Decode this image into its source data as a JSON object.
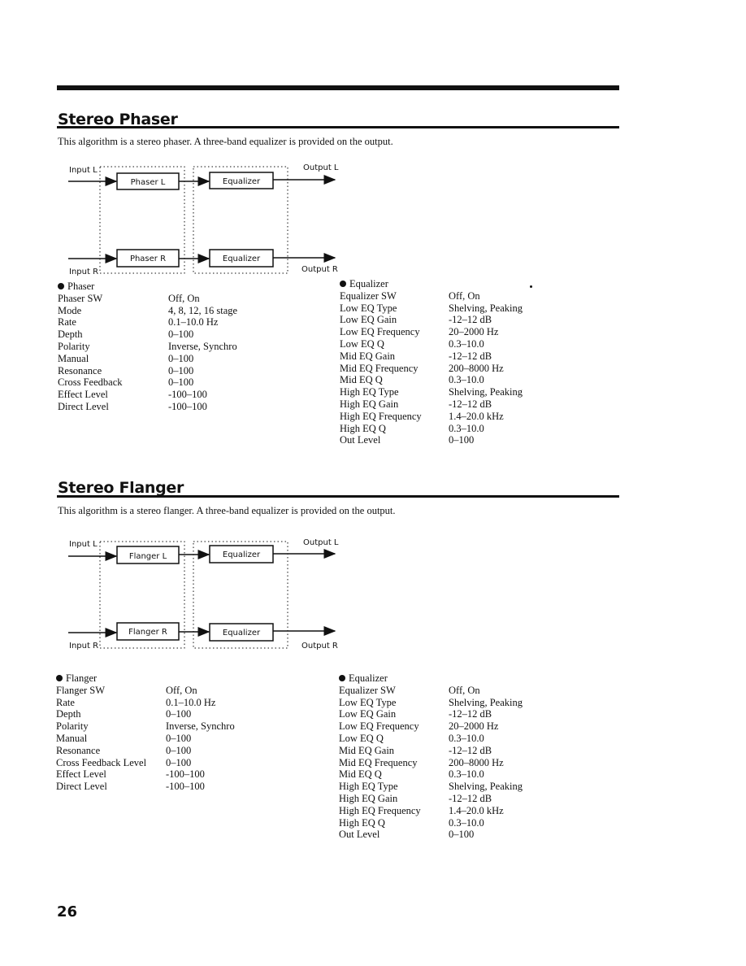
{
  "page_number": "26",
  "sections": [
    {
      "title": "Stereo Phaser",
      "description": "This algorithm is a stereo phaser. A three-band equalizer is provided on the output.",
      "diagram": {
        "input_l": "Input L",
        "input_r": "Input R",
        "output_l": "Output L",
        "output_r": "Output R",
        "effect_l": "Phaser L",
        "effect_r": "Phaser R",
        "eq_l": "Equalizer",
        "eq_r": "Equalizer"
      },
      "effect_params": {
        "heading": "Phaser",
        "rows": [
          {
            "name": "Phaser SW",
            "value": "Off, On"
          },
          {
            "name": "Mode",
            "value": "4, 8, 12, 16 stage"
          },
          {
            "name": "Rate",
            "value": "0.1–10.0 Hz"
          },
          {
            "name": "Depth",
            "value": "0–100"
          },
          {
            "name": "Polarity",
            "value": "Inverse, Synchro"
          },
          {
            "name": "Manual",
            "value": "0–100"
          },
          {
            "name": "Resonance",
            "value": "0–100"
          },
          {
            "name": "Cross Feedback",
            "value": "0–100"
          },
          {
            "name": "Effect Level",
            "value": "-100–100"
          },
          {
            "name": "Direct Level",
            "value": "-100–100"
          }
        ]
      },
      "eq_params": {
        "heading": "Equalizer",
        "rows": [
          {
            "name": "Equalizer SW",
            "value": "Off, On"
          },
          {
            "name": "Low EQ Type",
            "value": "Shelving, Peaking"
          },
          {
            "name": "Low EQ Gain",
            "value": "-12–12 dB"
          },
          {
            "name": "Low EQ Frequency",
            "value": "20–2000 Hz"
          },
          {
            "name": "Low EQ Q",
            "value": "0.3–10.0"
          },
          {
            "name": "Mid EQ Gain",
            "value": "-12–12 dB"
          },
          {
            "name": "Mid EQ Frequency",
            "value": "200–8000 Hz"
          },
          {
            "name": "Mid EQ Q",
            "value": "0.3–10.0"
          },
          {
            "name": "High EQ Type",
            "value": "Shelving, Peaking"
          },
          {
            "name": "High EQ Gain",
            "value": "-12–12 dB"
          },
          {
            "name": "High EQ Frequency",
            "value": "1.4–20.0 kHz"
          },
          {
            "name": "High EQ Q",
            "value": "0.3–10.0"
          },
          {
            "name": "Out Level",
            "value": "0–100"
          }
        ]
      }
    },
    {
      "title": "Stereo Flanger",
      "description": "This algorithm is a stereo flanger. A three-band equalizer is provided on the output.",
      "diagram": {
        "input_l": "Input L",
        "input_r": "Input R",
        "output_l": "Output L",
        "output_r": "Output R",
        "effect_l": "Flanger L",
        "effect_r": "Flanger R",
        "eq_l": "Equalizer",
        "eq_r": "Equalizer"
      },
      "effect_params": {
        "heading": "Flanger",
        "rows": [
          {
            "name": "Flanger SW",
            "value": "Off, On"
          },
          {
            "name": "Rate",
            "value": "0.1–10.0 Hz"
          },
          {
            "name": "Depth",
            "value": "0–100"
          },
          {
            "name": "Polarity",
            "value": "Inverse, Synchro"
          },
          {
            "name": "Manual",
            "value": "0–100"
          },
          {
            "name": "Resonance",
            "value": "0–100"
          },
          {
            "name": "Cross Feedback Level",
            "value": "0–100"
          },
          {
            "name": "Effect Level",
            "value": "-100–100"
          },
          {
            "name": "Direct Level",
            "value": "-100–100"
          }
        ]
      },
      "eq_params": {
        "heading": "Equalizer",
        "rows": [
          {
            "name": "Equalizer SW",
            "value": "Off, On"
          },
          {
            "name": "Low EQ Type",
            "value": "Shelving, Peaking"
          },
          {
            "name": "Low EQ Gain",
            "value": "-12–12 dB"
          },
          {
            "name": "Low EQ Frequency",
            "value": "20–2000 Hz"
          },
          {
            "name": "Low EQ Q",
            "value": "0.3–10.0"
          },
          {
            "name": "Mid EQ Gain",
            "value": "-12–12 dB"
          },
          {
            "name": "Mid EQ Frequency",
            "value": "200–8000 Hz"
          },
          {
            "name": "Mid EQ Q",
            "value": "0.3–10.0"
          },
          {
            "name": "High EQ Type",
            "value": "Shelving, Peaking"
          },
          {
            "name": "High EQ Gain",
            "value": "-12–12 dB"
          },
          {
            "name": "High EQ Frequency",
            "value": "1.4–20.0 kHz"
          },
          {
            "name": "High EQ Q",
            "value": "0.3–10.0"
          },
          {
            "name": "Out Level",
            "value": "0–100"
          }
        ]
      }
    }
  ]
}
